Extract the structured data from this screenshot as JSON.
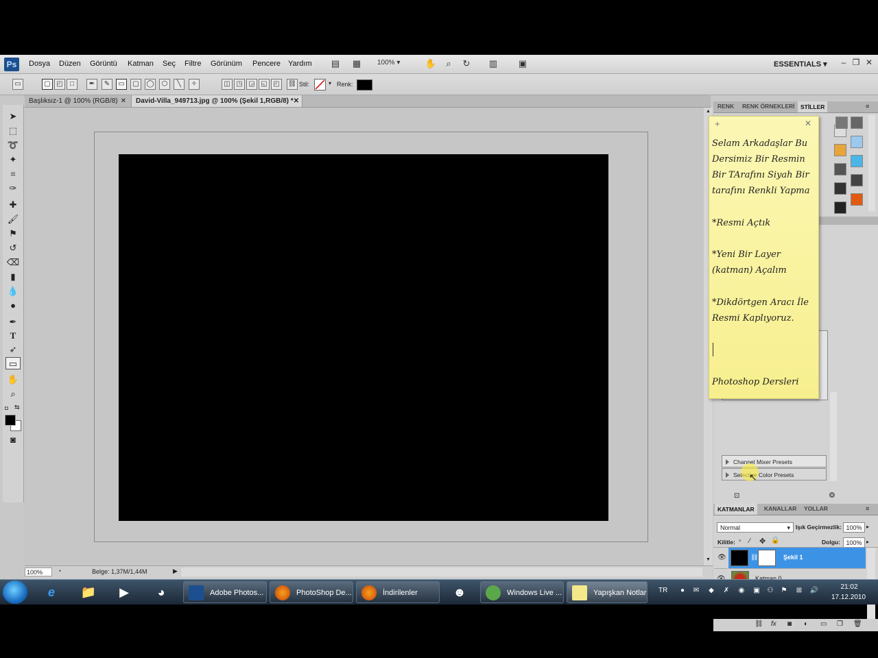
{
  "menu": {
    "items": [
      "Dosya",
      "Düzen",
      "Görüntü",
      "Katman",
      "Seç",
      "Filtre",
      "Görünüm",
      "Pencere",
      "Yardım"
    ],
    "zoom": "100%",
    "workspace": "ESSENTIALS"
  },
  "options": {
    "style_label": "Stil:",
    "color_label": "Renk:"
  },
  "tabs": [
    {
      "label": "Başlıksız-1 @ 100% (RGB/8)"
    },
    {
      "label": "David-Villa_949713.jpg @ 100% (Şekil 1,RGB/8) *"
    }
  ],
  "status": {
    "zoom": "100%",
    "doc": "Belge: 1,37M/1,44M"
  },
  "panels": {
    "top_tabs": [
      "RENK",
      "RENK ÖRNEKLERİ",
      "STİLLER"
    ],
    "presets": [
      {
        "label": "Channel Mixer Presets"
      },
      {
        "label": "Selective Color Presets"
      }
    ],
    "layers_tabs": [
      "KATMANLAR",
      "KANALLAR",
      "YOLLAR"
    ],
    "blend_mode": "Normal",
    "opacity_label": "Işık Geçirmezlik:",
    "opacity": "100%",
    "lock_label": "Kilitle:",
    "fill_label": "Dolgu:",
    "fill": "100%",
    "layers": [
      {
        "name": "Şekil 1"
      },
      {
        "name": "Katman 0"
      }
    ]
  },
  "sticky": {
    "lines": [
      "Selam Arkadaşlar Bu",
      "Dersimiz Bir Resmin",
      "Bir TArafını Siyah Bir",
      "tarafını Renkli Yapma",
      "*Resmi Açtık",
      "*Yeni Bir Layer",
      "(katman) Açalım",
      "*Dikdörtgen Aracı İle",
      "Resmi Kaplıyoruz.",
      "Photoshop Dersleri"
    ]
  },
  "taskbar": {
    "tasks": [
      {
        "label": "Adobe Photos..."
      },
      {
        "label": "PhotoShop De..."
      },
      {
        "label": "İndirilenler"
      },
      {
        "label": "Windows Live ..."
      },
      {
        "label": "Yapışkan Notlar"
      }
    ],
    "lang": "TR",
    "time": "21:02",
    "date": "17.12.2010"
  }
}
